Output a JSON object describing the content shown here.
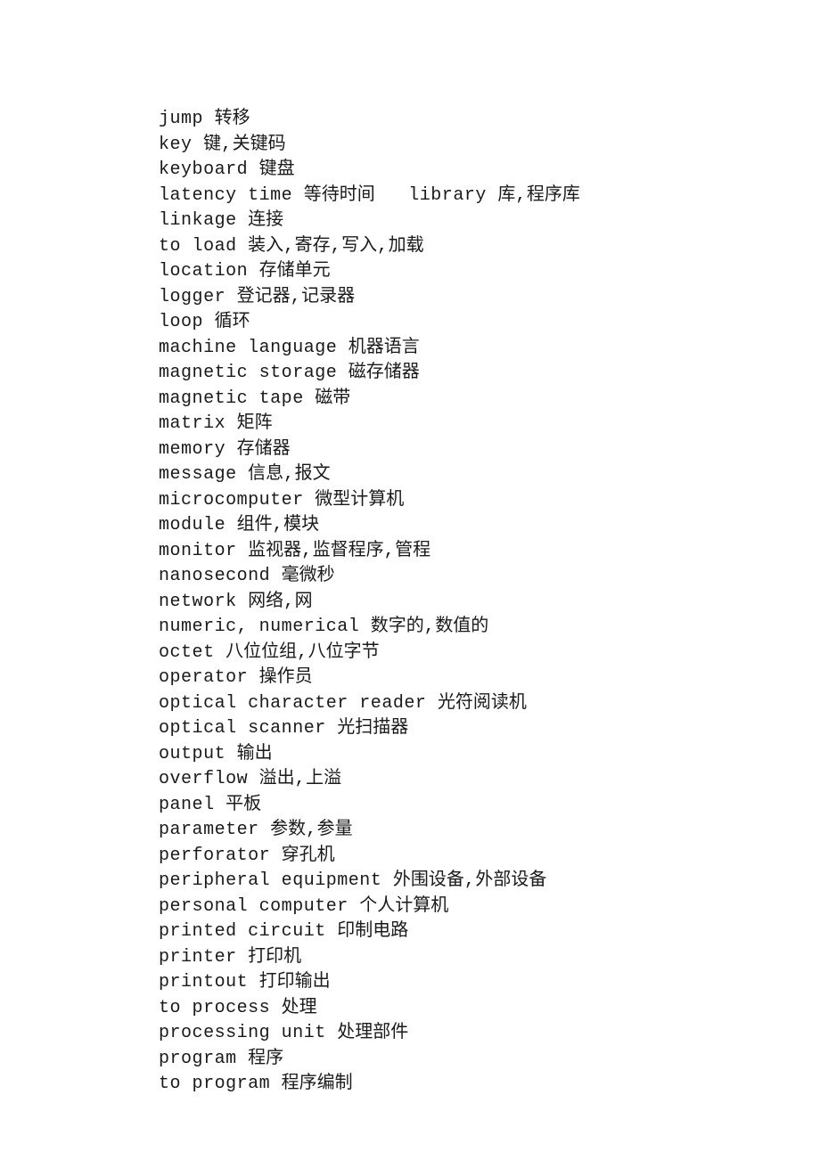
{
  "lines": [
    "jump 转移",
    "key 键,关键码",
    "keyboard 键盘",
    "latency time 等待时间   library 库,程序库",
    "linkage 连接",
    "to load 装入,寄存,写入,加载",
    "location 存储单元",
    "logger 登记器,记录器",
    "loop 循环",
    "machine language 机器语言",
    "magnetic storage 磁存储器",
    "magnetic tape 磁带",
    "matrix 矩阵",
    "memory 存储器",
    "message 信息,报文",
    "microcomputer 微型计算机",
    "module 组件,模块",
    "monitor 监视器,监督程序,管程",
    "nanosecond 毫微秒",
    "network 网络,网",
    "numeric, numerical 数字的,数值的",
    "octet 八位位组,八位字节",
    "operator 操作员",
    "optical character reader 光符阅读机",
    "optical scanner 光扫描器",
    "output 输出",
    "overflow 溢出,上溢",
    "panel 平板",
    "parameter 参数,参量",
    "perforator 穿孔机",
    "peripheral equipment 外围设备,外部设备",
    "personal computer 个人计算机",
    "printed circuit 印制电路",
    "printer 打印机",
    "printout 打印输出",
    "to process 处理",
    "processing unit 处理部件",
    "program 程序",
    "to program 程序编制"
  ]
}
